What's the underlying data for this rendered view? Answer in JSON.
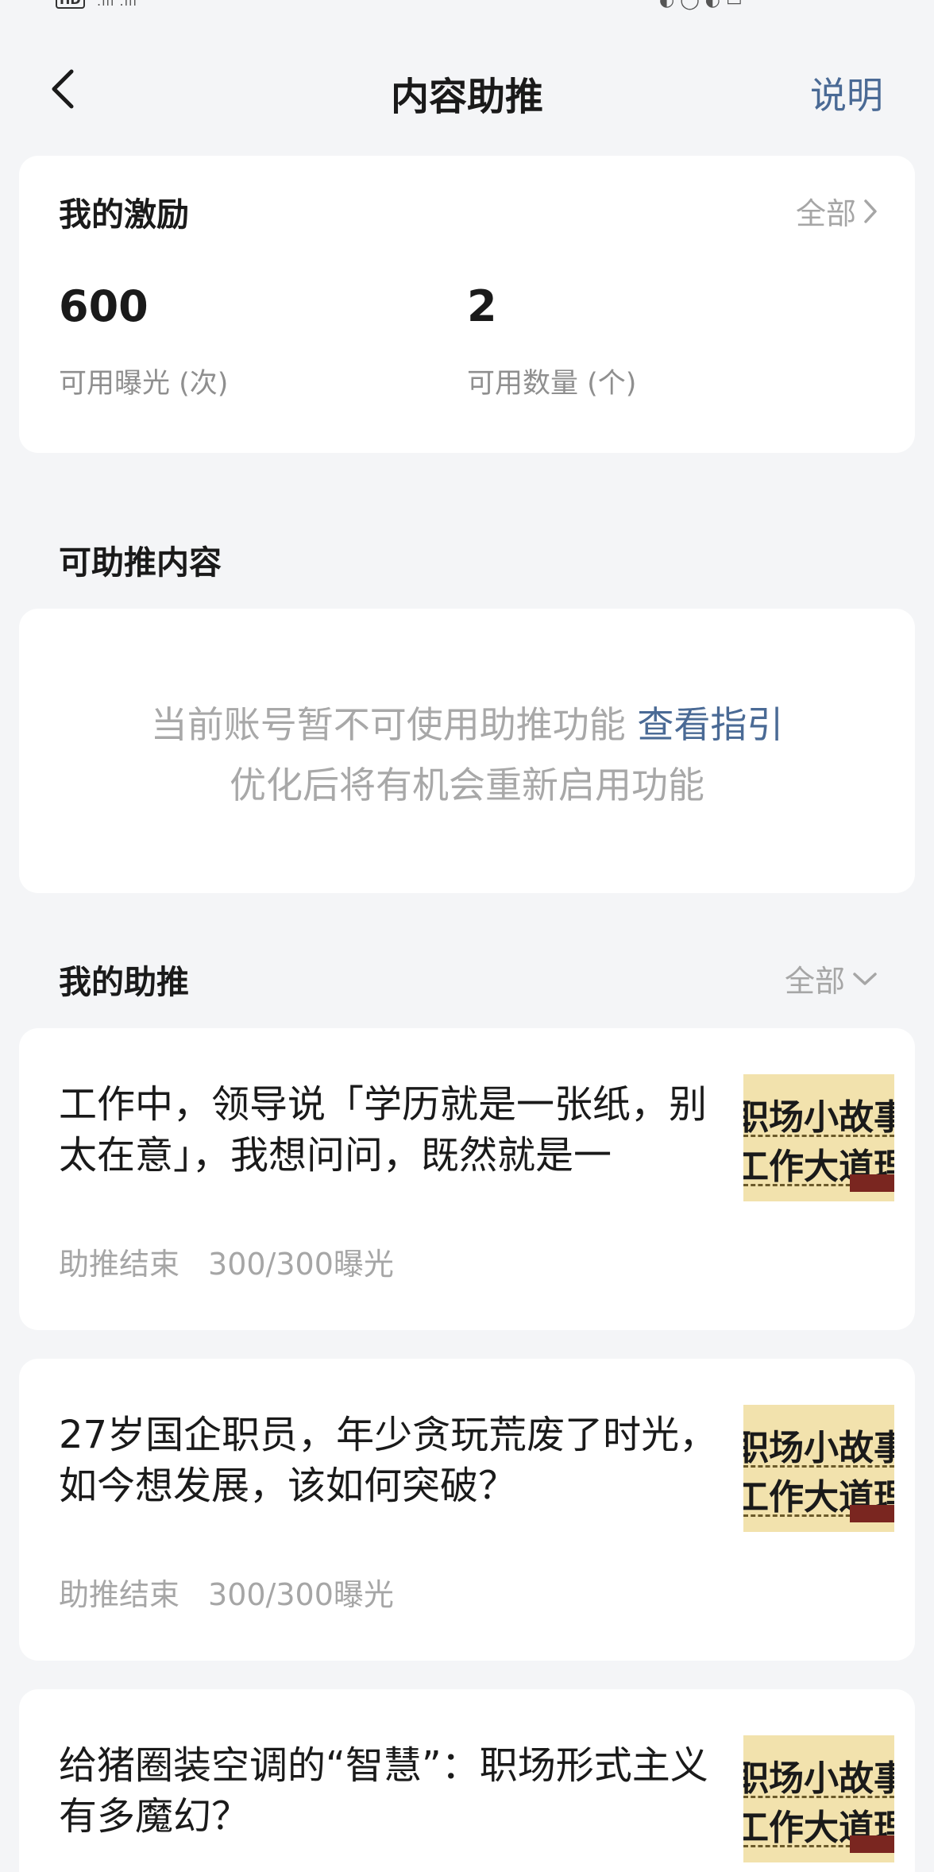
{
  "nav": {
    "title": "内容助推",
    "explain_label": "说明"
  },
  "incentive": {
    "title": "我的激励",
    "all_label": "全部",
    "stats": [
      {
        "value": "600",
        "label": "可用曝光 (次)"
      },
      {
        "value": "2",
        "label": "可用数量 (个)"
      }
    ]
  },
  "boostable": {
    "title": "可助推内容",
    "notice_line1": "当前账号暂不可使用助推功能",
    "guide_link": "查看指引",
    "notice_line2": "优化后将有机会重新启用功能"
  },
  "my_boosts": {
    "title": "我的助推",
    "all_label": "全部",
    "items": [
      {
        "title": "工作中，领导说「学历就是一张纸，别太在意」，我想问问，既然就是一",
        "status": "助推结束",
        "exposure": "300/300曝光",
        "thumb_line1": "职场小故事",
        "thumb_line2": "工作大道理"
      },
      {
        "title": "27岁国企职员，年少贪玩荒废了时光，如今想发展，该如何突破？",
        "status": "助推结束",
        "exposure": "300/300曝光",
        "thumb_line1": "职场小故事",
        "thumb_line2": "工作大道理"
      },
      {
        "title": "给猪圈装空调的“智慧”：职场形式主义有多魔幻？",
        "status": "",
        "exposure": "",
        "thumb_line1": "职场小故事",
        "thumb_line2": "工作大道理"
      }
    ]
  },
  "icons": {
    "back": "chevron-left-icon",
    "all_incentive": "chevron-right-icon",
    "all_boosts": "chevron-down-icon"
  }
}
